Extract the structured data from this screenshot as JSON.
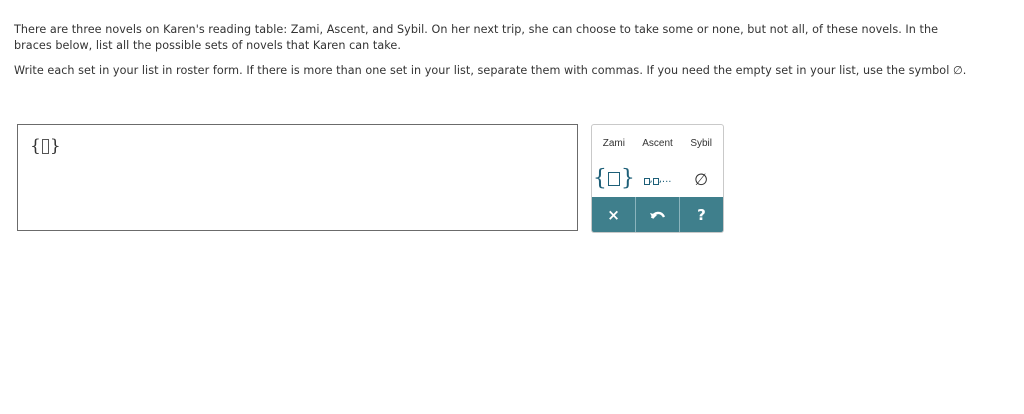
{
  "question": {
    "paragraph1": "There are three novels on Karen's reading table: Zami, Ascent, and Sybil. On her next trip, she can choose to take some or none, but not all, of these novels. In the braces below, list all the possible sets of novels that Karen can take.",
    "paragraph2": "Write each set in your list in roster form. If there is more than one set in your list, separate them with commas. If you need the empty set in your list, use the symbol ∅."
  },
  "answer": {
    "open_brace": "{",
    "close_brace": "}"
  },
  "keypad": {
    "words": [
      "Zami",
      "Ascent",
      "Sybil"
    ],
    "set_template": {
      "open": "{",
      "close": "}"
    },
    "list_template": {
      "sep1": ",",
      "sep2": ",",
      "ellipsis": "..."
    },
    "empty_set_symbol": "∅",
    "actions": {
      "clear": "×",
      "undo": "↶",
      "help": "?"
    },
    "icons": {
      "clear": "close-icon",
      "undo": "undo-icon",
      "help": "help-icon"
    },
    "colors": {
      "action_bar": "#3f7f8c",
      "symbol_accent": "#1d5f78"
    }
  }
}
